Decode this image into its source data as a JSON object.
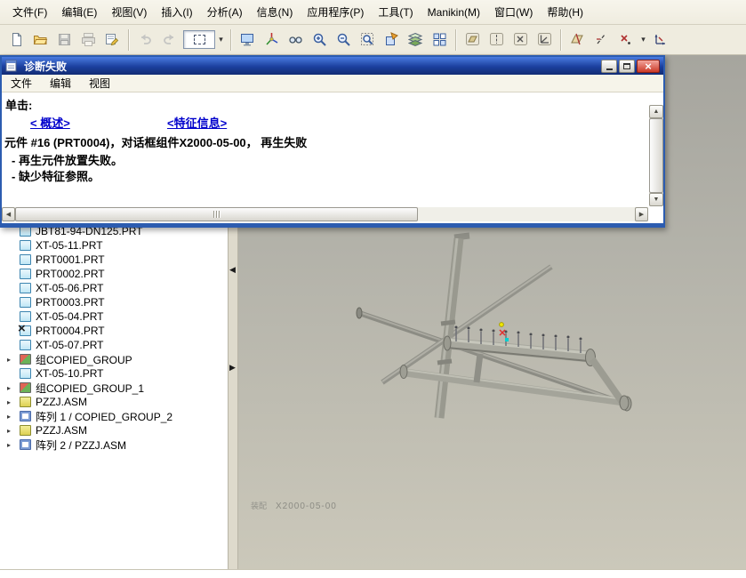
{
  "menubar": {
    "items": [
      "文件(F)",
      "编辑(E)",
      "视图(V)",
      "插入(I)",
      "分析(A)",
      "信息(N)",
      "应用程序(P)",
      "工具(T)",
      "Manikin(M)",
      "窗口(W)",
      "帮助(H)"
    ]
  },
  "toolbar": {
    "icons": [
      "new-file",
      "open-file",
      "save",
      "print",
      "properties",
      "undo",
      "redo",
      "selection-filter",
      "selection-filter-dropdown",
      "repaint",
      "spin-center",
      "orient-mode",
      "zoom-in",
      "zoom-out",
      "refit",
      "saved-view-list",
      "layers",
      "view-manager",
      "datum-plane-display",
      "datum-axis-display",
      "datum-point-display",
      "csys-display",
      "datum-plane-tool",
      "datum-axis-tool",
      "datum-point-tool",
      "datum-point-options",
      "csys-tool"
    ]
  },
  "dialog": {
    "title": "诊断失败",
    "menu": [
      "文件",
      "编辑",
      "视图"
    ],
    "prompt": "单击:",
    "links": [
      "< 概述>",
      "<特征信息>"
    ],
    "lines": [
      "元件 #16 (PRT0004)，对话框组件X2000-05-00， 再生失败",
      "- 再生元件放置失败。",
      "- 缺少特征参照。"
    ]
  },
  "tree": {
    "items": [
      {
        "label": "JBT81-94-DN125.PRT",
        "type": "part",
        "expandable": false
      },
      {
        "label": "XT-05-11.PRT",
        "type": "part",
        "expandable": false
      },
      {
        "label": "PRT0001.PRT",
        "type": "part",
        "expandable": false
      },
      {
        "label": "PRT0002.PRT",
        "type": "part",
        "expandable": false
      },
      {
        "label": "XT-05-06.PRT",
        "type": "part",
        "expandable": false
      },
      {
        "label": "PRT0003.PRT",
        "type": "part",
        "expandable": false
      },
      {
        "label": "XT-05-04.PRT",
        "type": "part",
        "expandable": false
      },
      {
        "label": "PRT0004.PRT",
        "type": "part-failed",
        "expandable": false
      },
      {
        "label": "XT-05-07.PRT",
        "type": "part",
        "expandable": false
      },
      {
        "label": "组COPIED_GROUP",
        "type": "group",
        "expandable": true
      },
      {
        "label": "XT-05-10.PRT",
        "type": "part",
        "expandable": false
      },
      {
        "label": "组COPIED_GROUP_1",
        "type": "group",
        "expandable": true
      },
      {
        "label": "PZZJ.ASM",
        "type": "assembly",
        "expandable": true
      },
      {
        "label": "阵列 1 / COPIED_GROUP_2",
        "type": "pattern",
        "expandable": true
      },
      {
        "label": "PZZJ.ASM",
        "type": "assembly",
        "expandable": true
      },
      {
        "label": "阵列 2 / PZZJ.ASM",
        "type": "pattern",
        "expandable": true
      }
    ]
  },
  "viewport": {
    "watermark_prefix": "装配",
    "watermark_model": "X2000-05-00"
  },
  "colors": {
    "titlebar": "#1c3f9e",
    "link": "#0000cc",
    "close_button": "#cc3a28",
    "viewport_top": "#a6a59e",
    "viewport_bottom": "#cbc8ba"
  }
}
